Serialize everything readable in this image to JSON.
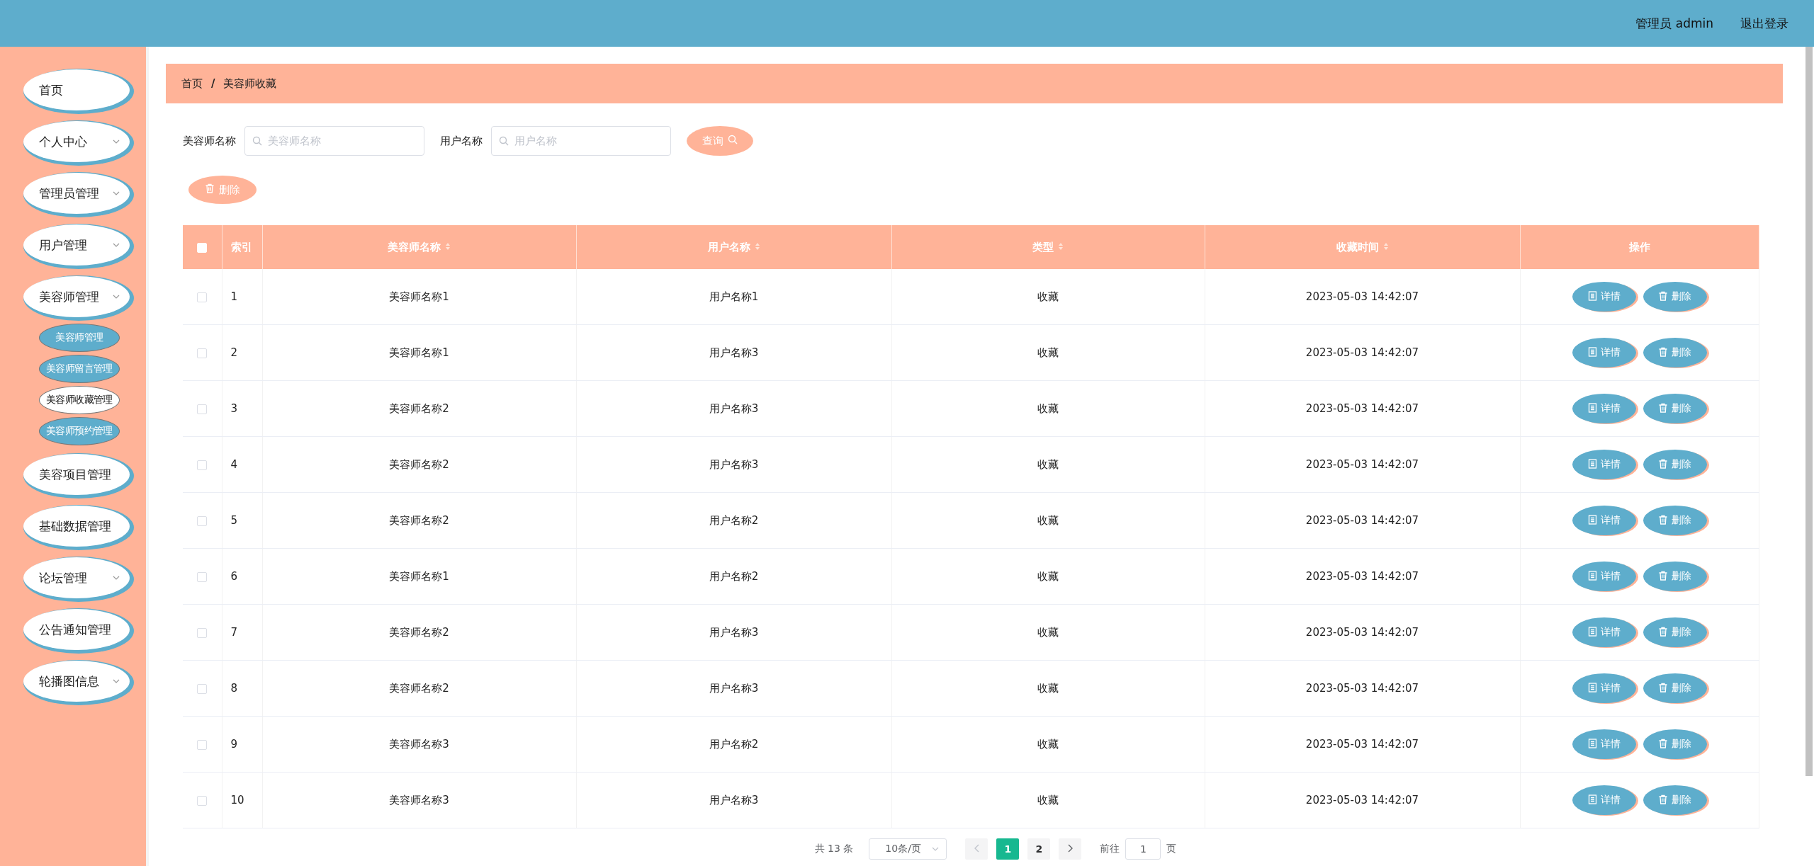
{
  "header": {
    "user": "管理员 admin",
    "logout": "退出登录"
  },
  "sidebar": {
    "items": [
      {
        "label": "首页",
        "kind": "link"
      },
      {
        "label": "个人中心",
        "kind": "group"
      },
      {
        "label": "管理员管理",
        "kind": "group"
      },
      {
        "label": "用户管理",
        "kind": "group"
      },
      {
        "label": "美容师管理",
        "kind": "group",
        "children": [
          {
            "label": "美容师管理",
            "selected": false
          },
          {
            "label": "美容师留言管理",
            "selected": false
          },
          {
            "label": "美容师收藏管理",
            "selected": true
          },
          {
            "label": "美容师预约管理",
            "selected": false
          }
        ]
      },
      {
        "label": "美容项目管理",
        "kind": "link"
      },
      {
        "label": "基础数据管理",
        "kind": "link"
      },
      {
        "label": "论坛管理",
        "kind": "group"
      },
      {
        "label": "公告通知管理",
        "kind": "link"
      },
      {
        "label": "轮播图信息",
        "kind": "group"
      }
    ]
  },
  "breadcrumb": {
    "items": [
      "首页",
      "美容师收藏"
    ],
    "separator": "/"
  },
  "search": {
    "fields": [
      {
        "label": "美容师名称",
        "placeholder": "美容师名称"
      },
      {
        "label": "用户名称",
        "placeholder": "用户名称"
      }
    ],
    "button": "查询"
  },
  "toolbar": {
    "delete": "删除"
  },
  "table": {
    "select_all": false,
    "columns": [
      {
        "label": "索引",
        "sortable": false
      },
      {
        "label": "美容师名称",
        "sortable": true
      },
      {
        "label": "用户名称",
        "sortable": true
      },
      {
        "label": "类型",
        "sortable": true
      },
      {
        "label": "收藏时间",
        "sortable": true
      },
      {
        "label": "操作",
        "sortable": false
      }
    ],
    "rows": [
      {
        "checked": false,
        "index": "1",
        "beautician": "美容师名称1",
        "user": "用户名称1",
        "type": "收藏",
        "time": "2023-05-03 14:42:07",
        "actions": [
          "详情",
          "删除"
        ]
      },
      {
        "checked": false,
        "index": "2",
        "beautician": "美容师名称1",
        "user": "用户名称3",
        "type": "收藏",
        "time": "2023-05-03 14:42:07",
        "actions": [
          "详情",
          "删除"
        ]
      },
      {
        "checked": false,
        "index": "3",
        "beautician": "美容师名称2",
        "user": "用户名称3",
        "type": "收藏",
        "time": "2023-05-03 14:42:07",
        "actions": [
          "详情",
          "删除"
        ]
      },
      {
        "checked": false,
        "index": "4",
        "beautician": "美容师名称2",
        "user": "用户名称3",
        "type": "收藏",
        "time": "2023-05-03 14:42:07",
        "actions": [
          "详情",
          "删除"
        ]
      },
      {
        "checked": false,
        "index": "5",
        "beautician": "美容师名称2",
        "user": "用户名称2",
        "type": "收藏",
        "time": "2023-05-03 14:42:07",
        "actions": [
          "详情",
          "删除"
        ]
      },
      {
        "checked": false,
        "index": "6",
        "beautician": "美容师名称1",
        "user": "用户名称2",
        "type": "收藏",
        "time": "2023-05-03 14:42:07",
        "actions": [
          "详情",
          "删除"
        ]
      },
      {
        "checked": false,
        "index": "7",
        "beautician": "美容师名称2",
        "user": "用户名称3",
        "type": "收藏",
        "time": "2023-05-03 14:42:07",
        "actions": [
          "详情",
          "删除"
        ]
      },
      {
        "checked": false,
        "index": "8",
        "beautician": "美容师名称2",
        "user": "用户名称3",
        "type": "收藏",
        "time": "2023-05-03 14:42:07",
        "actions": [
          "详情",
          "删除"
        ]
      },
      {
        "checked": false,
        "index": "9",
        "beautician": "美容师名称3",
        "user": "用户名称2",
        "type": "收藏",
        "time": "2023-05-03 14:42:07",
        "actions": [
          "详情",
          "删除"
        ]
      },
      {
        "checked": false,
        "index": "10",
        "beautician": "美容师名称3",
        "user": "用户名称3",
        "type": "收藏",
        "time": "2023-05-03 14:42:07",
        "actions": [
          "详情",
          "删除"
        ]
      }
    ]
  },
  "pagination": {
    "total": "共 13 条",
    "page_size": "10条/页",
    "pages": [
      {
        "label": "1",
        "selected": true
      },
      {
        "label": "2",
        "selected": false
      }
    ],
    "goto_label": "前往",
    "goto_value": "1",
    "goto_suffix": "页"
  }
}
